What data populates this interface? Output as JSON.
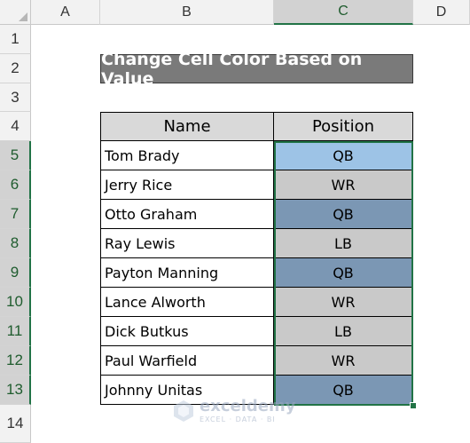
{
  "columns": [
    "A",
    "B",
    "C",
    "D"
  ],
  "rows": [
    "1",
    "2",
    "3",
    "4",
    "5",
    "6",
    "7",
    "8",
    "9",
    "10",
    "11",
    "12",
    "13",
    "14"
  ],
  "title": "Change Cell Color Based on Value",
  "table": {
    "headers": {
      "name": "Name",
      "position": "Position"
    },
    "rows": [
      {
        "name": "Tom Brady",
        "position": "QB"
      },
      {
        "name": "Jerry Rice",
        "position": "WR"
      },
      {
        "name": "Otto Graham",
        "position": "QB"
      },
      {
        "name": "Ray Lewis",
        "position": "LB"
      },
      {
        "name": "Payton Manning",
        "position": "QB"
      },
      {
        "name": "Lance Alworth",
        "position": "WR"
      },
      {
        "name": "Dick Butkus",
        "position": "LB"
      },
      {
        "name": "Paul Warfield",
        "position": "WR"
      },
      {
        "name": "Johnny Unitas",
        "position": "QB"
      }
    ]
  },
  "cell_fills": [
    "#9dc3e6",
    "#c9c9c9",
    "#7b97b4",
    "#c9c9c9",
    "#7b97b4",
    "#c9c9c9",
    "#c9c9c9",
    "#c9c9c9",
    "#7b97b4"
  ],
  "selection_color": "#217346",
  "watermark": {
    "name": "exceldemy",
    "tagline": "EXCEL · DATA · BI",
    "icon": "exceldemy-logo-icon"
  }
}
